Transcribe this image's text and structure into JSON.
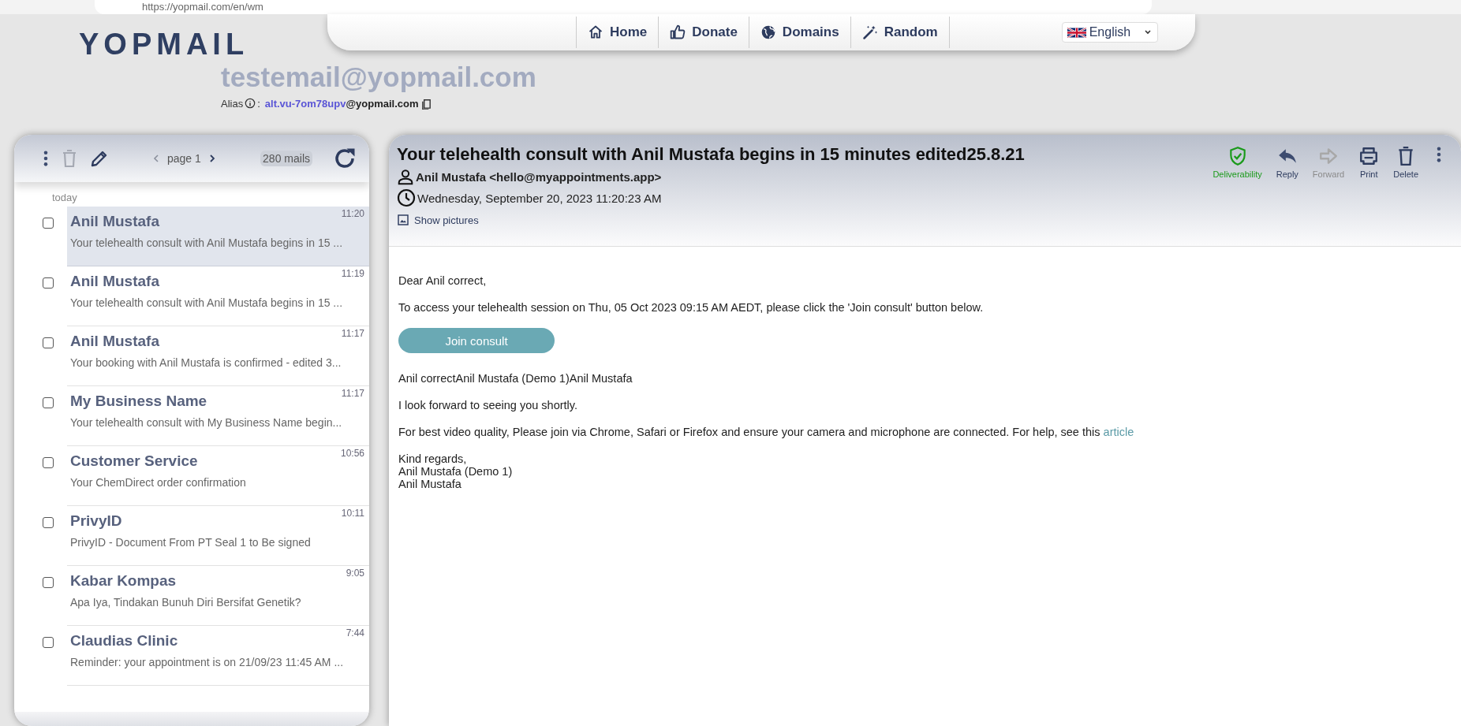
{
  "browser": {
    "url": "https://yopmail.com/en/wm"
  },
  "logo": "YOPMAIL",
  "nav": {
    "items": [
      {
        "label": "Home",
        "kind": "home"
      },
      {
        "label": "Donate",
        "kind": "thumb"
      },
      {
        "label": "Domains",
        "kind": "globe"
      },
      {
        "label": "Random",
        "kind": "wand"
      }
    ],
    "language": "English"
  },
  "account": {
    "email": "testemail@yopmail.com",
    "alias_label": "Alias",
    "alias_separator": ":",
    "alias_name": "alt.vu-7om78upv",
    "alias_domain": "@yopmail.com"
  },
  "inbox": {
    "page": "page 1",
    "count": "280 mails",
    "group": "today",
    "mails": [
      {
        "sender": "Anil Mustafa",
        "subject": "Your telehealth consult with Anil Mustafa begins in 15 ...",
        "time": "11:20",
        "checked": false,
        "selected": true
      },
      {
        "sender": "Anil Mustafa",
        "subject": "Your telehealth consult with Anil Mustafa begins in 15 ...",
        "time": "11:19",
        "checked": false,
        "selected": false
      },
      {
        "sender": "Anil Mustafa",
        "subject": "Your booking with Anil Mustafa is confirmed - edited 3...",
        "time": "11:17",
        "checked": false,
        "selected": false
      },
      {
        "sender": "My Business Name",
        "subject": "Your telehealth consult with My Business Name begin...",
        "time": "11:17",
        "checked": false,
        "selected": false
      },
      {
        "sender": "Customer Service",
        "subject": "Your ChemDirect order confirmation",
        "time": "10:56",
        "checked": false,
        "selected": false
      },
      {
        "sender": "PrivyID",
        "subject": "PrivyID - Document From PT Seal 1 to Be signed",
        "time": "10:11",
        "checked": false,
        "selected": false
      },
      {
        "sender": "Kabar Kompas",
        "subject": "Apa Iya, Tindakan Bunuh Diri Bersifat Genetik?",
        "time": "9:05",
        "checked": false,
        "selected": false
      },
      {
        "sender": "Claudias Clinic",
        "subject": "Reminder: your appointment is on 21/09/23 11:45 AM ...",
        "time": "7:44",
        "checked": false,
        "selected": false
      }
    ]
  },
  "message": {
    "subject": "Your telehealth consult with Anil Mustafa begins in 15 minutes edited25.8.21",
    "from": "Anil Mustafa <hello@myappointments.app>",
    "date": "Wednesday, September 20, 2023 11:20:23 AM",
    "show_pictures": "Show pictures",
    "actions": [
      {
        "label": "Deliverability",
        "kind": "shield",
        "disabled": false
      },
      {
        "label": "Reply",
        "kind": "reply",
        "disabled": false
      },
      {
        "label": "Forward",
        "kind": "forward",
        "disabled": true
      },
      {
        "label": "Print",
        "kind": "print",
        "disabled": false
      },
      {
        "label": "Delete",
        "kind": "trash",
        "disabled": false
      }
    ],
    "body": [
      {
        "kind": "text",
        "text": "Dear Anil correct,"
      },
      {
        "kind": "text",
        "text": "To access your telehealth session on Thu, 05 Oct 2023 09:15 AM AEDT, please click the 'Join consult' button below."
      },
      {
        "kind": "button",
        "text": "Join consult"
      },
      {
        "kind": "text",
        "text": "Anil correctAnil Mustafa (Demo 1)Anil Mustafa"
      },
      {
        "kind": "text",
        "text": "I look forward to seeing you shortly."
      },
      {
        "kind": "link",
        "text": "For best video quality, Please join via Chrome, Safari or Firefox and ensure your camera and microphone are connected. For help, see this",
        "link": "article"
      },
      {
        "kind": "lines",
        "lines": [
          "Kind regards,",
          "Anil Mustafa (Demo 1)",
          "Anil Mustafa"
        ]
      }
    ]
  }
}
